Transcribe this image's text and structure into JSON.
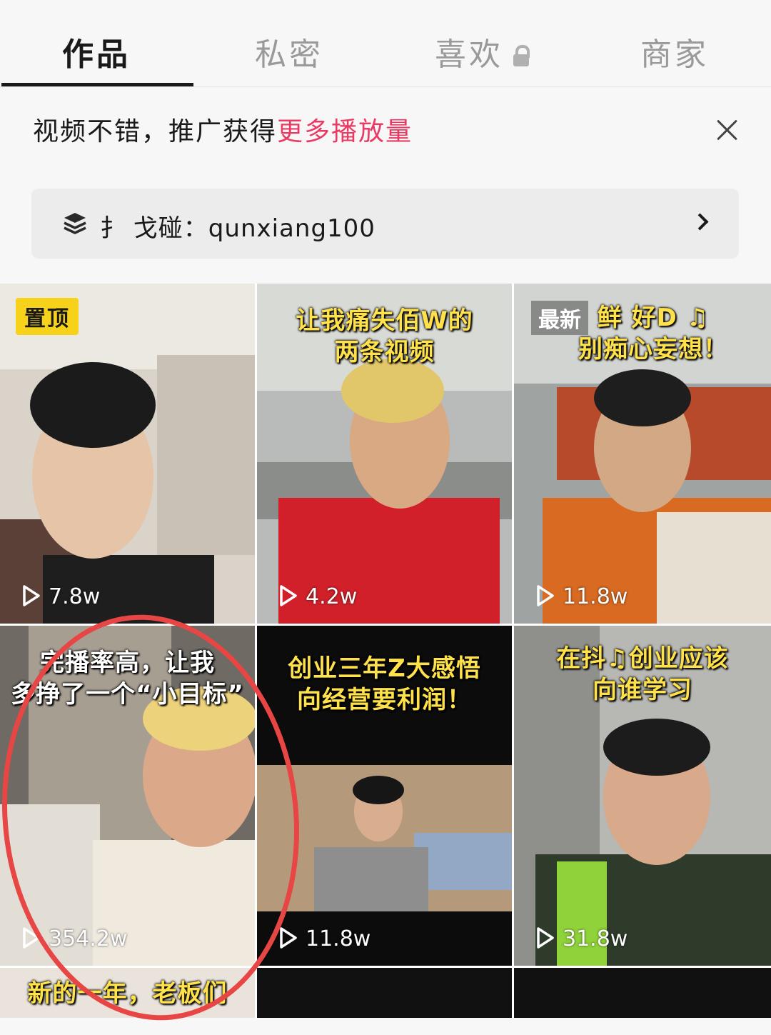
{
  "tabs": [
    {
      "label": "作品",
      "active": true
    },
    {
      "label": "私密",
      "active": false
    },
    {
      "label": "喜欢",
      "active": false,
      "icon": "lock-icon"
    },
    {
      "label": "商家",
      "active": false
    }
  ],
  "promo": {
    "text": "视频不错，推广获得",
    "link": "更多播放量",
    "close_icon": "close-icon",
    "link_color": "#ea3a63"
  },
  "banner": {
    "icon": "layers-icon",
    "text": "扌 戈碰：qunxiang100",
    "arrow_icon": "chevron-right-icon"
  },
  "videos": [
    {
      "badge": "置顶",
      "caption": "",
      "plays": "7.8w"
    },
    {
      "badge": "",
      "caption_line1": "让我痛失佰W的",
      "caption_line2": "两条视频",
      "plays": "4.2w"
    },
    {
      "badge": "最新",
      "caption_line1": "鲜 好D ♫",
      "caption_line2": "别痴心妄想！",
      "plays": "11.8w"
    },
    {
      "badge": "",
      "caption_line1": "完播率高，让我",
      "caption_line2": "多挣了一个“小目标”",
      "plays": "354.2w"
    },
    {
      "badge": "",
      "caption_line1": "创业三年Z大感悟",
      "caption_line2": "向经营要利润！",
      "plays": "11.8w"
    },
    {
      "badge": "",
      "caption_line1": "在抖♫创业应该",
      "caption_line2": "向谁学习",
      "plays": "31.8w"
    }
  ],
  "partial_row": {
    "caption": "新的一年，老板们"
  },
  "colors": {
    "accent": "#ea3a63",
    "highlight_circle": "#e84545",
    "pin_badge": "#f6d21b"
  }
}
